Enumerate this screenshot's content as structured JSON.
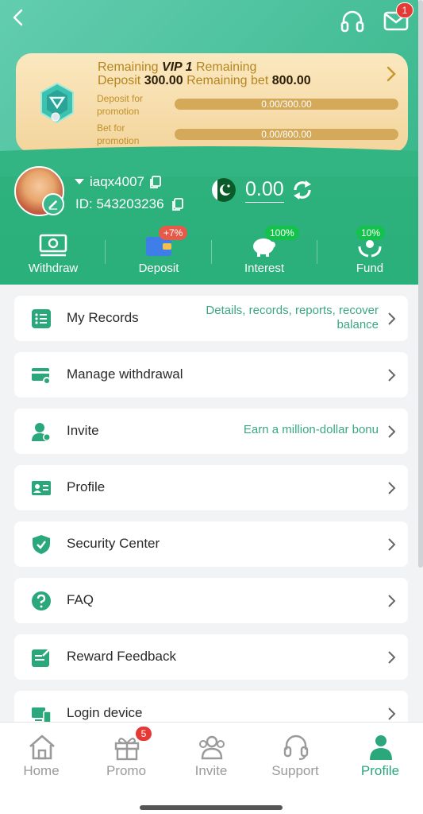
{
  "header": {
    "back_icon": "chevron-left-icon",
    "support_icon": "headset-icon",
    "mail_icon": "envelope-icon",
    "mail_badge": "1"
  },
  "vip": {
    "remaining1": "Remaining",
    "level": "VIP 1",
    "remaining2": "Remaining",
    "deposit_label": "Deposit",
    "deposit_amount": "300.00",
    "remaining_bet_label": "Remaining bet",
    "bet_amount": "800.00",
    "deposit_promo_line1": "Deposit for",
    "deposit_promo_line2": "promotion",
    "deposit_progress": "0.00/300.00",
    "deposit_progress_fraction": 0,
    "bet_promo_line1": "Bet for",
    "bet_promo_line2": "promotion",
    "bet_progress": "0.00/800.00",
    "bet_progress_fraction": 0
  },
  "user": {
    "username": "iaqx4007",
    "id": "ID: 543203236",
    "balance": "0.00"
  },
  "actions": [
    {
      "label": "Withdraw",
      "icon": "cash-icon",
      "badge": ""
    },
    {
      "label": "Deposit",
      "icon": "wallet-icon",
      "badge": "+7%"
    },
    {
      "label": "Interest",
      "icon": "piggy-bank-icon",
      "badge": "100%"
    },
    {
      "label": "Fund",
      "icon": "hands-coin-icon",
      "badge": "10%"
    }
  ],
  "menu": [
    {
      "label": "My Records",
      "hint": "Details, records, reports, recover balance",
      "icon": "list-icon"
    },
    {
      "label": "Manage withdrawal",
      "hint": "",
      "icon": "card-gear-icon"
    },
    {
      "label": "Invite",
      "hint": "Earn a million-dollar bonu",
      "icon": "user-add-icon"
    },
    {
      "label": "Profile",
      "hint": "",
      "icon": "id-card-icon"
    },
    {
      "label": "Security Center",
      "hint": "",
      "icon": "shield-check-icon"
    },
    {
      "label": "FAQ",
      "hint": "",
      "icon": "question-icon"
    },
    {
      "label": "Reward Feedback",
      "hint": "",
      "icon": "edit-note-icon"
    },
    {
      "label": "Login device",
      "hint": "",
      "icon": "devices-icon"
    }
  ],
  "nav": [
    {
      "label": "Home",
      "icon": "home-icon"
    },
    {
      "label": "Promo",
      "icon": "gift-icon",
      "badge": "5"
    },
    {
      "label": "Invite",
      "icon": "users-icon"
    },
    {
      "label": "Support",
      "icon": "headset-icon"
    },
    {
      "label": "Profile",
      "icon": "person-icon"
    }
  ],
  "colors": {
    "brand": "#2ab07a",
    "accent_text": "#3aa783",
    "vip_gold": "#d4a95a",
    "badge_red": "#e53935"
  }
}
